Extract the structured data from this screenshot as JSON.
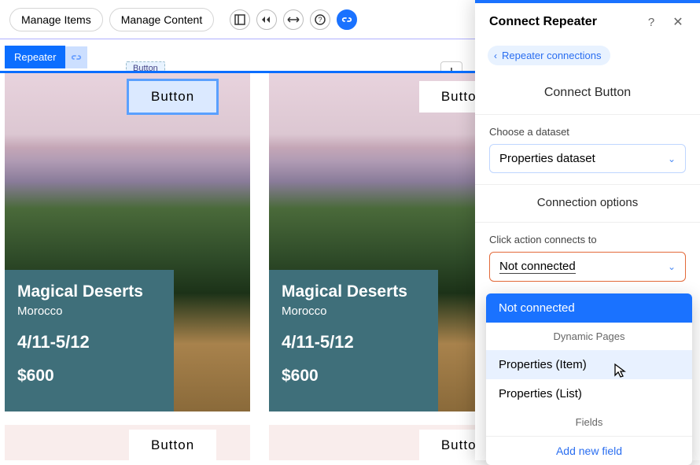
{
  "toolbar": {
    "manage_items": "Manage Items",
    "manage_content": "Manage Content"
  },
  "repeater": {
    "label": "Repeater"
  },
  "sel_badge": "Button",
  "cards": [
    {
      "button": "Button",
      "title": "Magical Deserts",
      "sub": "Morocco",
      "dates": "4/11-5/12",
      "price": "$600"
    },
    {
      "button": "Button",
      "title": "Magical Deserts",
      "sub": "Morocco",
      "dates": "4/11-5/12",
      "price": "$600"
    }
  ],
  "bottom_buttons": [
    "Button",
    "Button"
  ],
  "panel": {
    "title": "Connect Repeater",
    "back": "Repeater connections",
    "section1": "Connect Button",
    "dataset_label": "Choose a dataset",
    "dataset_value": "Properties dataset",
    "section2": "Connection options",
    "click_label": "Click action connects to",
    "click_value": "Not connected",
    "dropdown": {
      "selected": "Not connected",
      "group1": "Dynamic Pages",
      "opt1": "Properties (Item)",
      "opt2": "Properties (List)",
      "group2": "Fields",
      "add": "Add new field"
    }
  }
}
